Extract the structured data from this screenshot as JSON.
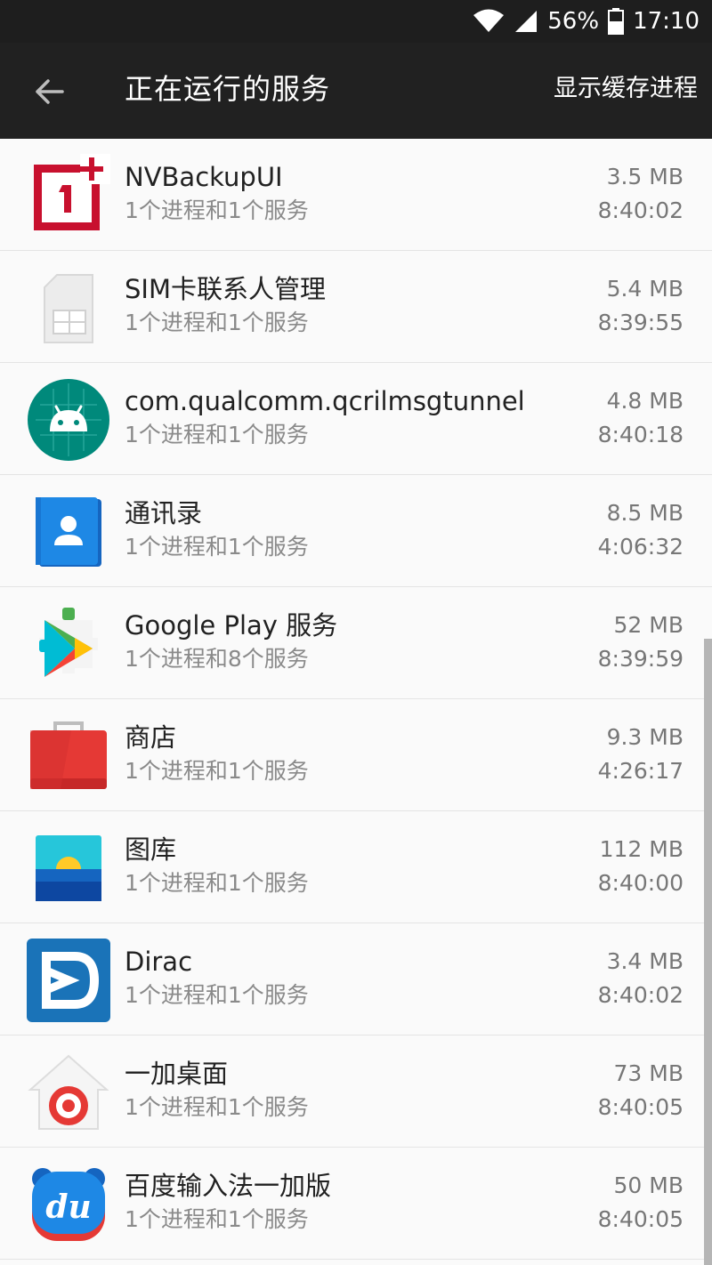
{
  "status_bar": {
    "battery_percent": "56%",
    "time": "17:10",
    "icons": [
      "wifi-icon",
      "signal-icon",
      "battery-icon"
    ]
  },
  "app_bar": {
    "back_icon": "arrow-left-icon",
    "title": "正在运行的服务",
    "action_label": "显示缓存进程"
  },
  "services": [
    {
      "name": "NVBackupUI",
      "desc": "1个进程和1个服务",
      "size": "3.5 MB",
      "time": "8:40:02",
      "icon": "oneplus-icon"
    },
    {
      "name": "SIM卡联系人管理",
      "desc": "1个进程和1个服务",
      "size": "5.4 MB",
      "time": "8:39:55",
      "icon": "sim-card-icon"
    },
    {
      "name": "com.qualcomm.qcrilmsgtunnel",
      "desc": "1个进程和1个服务",
      "size": "4.8 MB",
      "time": "8:40:18",
      "icon": "android-icon"
    },
    {
      "name": "通讯录",
      "desc": "1个进程和1个服务",
      "size": "8.5 MB",
      "time": "4:06:32",
      "icon": "contacts-icon"
    },
    {
      "name": "Google Play 服务",
      "desc": "1个进程和8个服务",
      "size": "52 MB",
      "time": "8:39:59",
      "icon": "google-play-services-icon"
    },
    {
      "name": "商店",
      "desc": "1个进程和1个服务",
      "size": "9.3 MB",
      "time": "4:26:17",
      "icon": "store-bag-icon"
    },
    {
      "name": "图库",
      "desc": "1个进程和1个服务",
      "size": "112 MB",
      "time": "8:40:00",
      "icon": "gallery-icon"
    },
    {
      "name": "Dirac",
      "desc": "1个进程和1个服务",
      "size": "3.4 MB",
      "time": "8:40:02",
      "icon": "dirac-icon"
    },
    {
      "name": "一加桌面",
      "desc": "1个进程和1个服务",
      "size": "73 MB",
      "time": "8:40:05",
      "icon": "launcher-home-icon"
    },
    {
      "name": "百度输入法一加版",
      "desc": "1个进程和1个服务",
      "size": "50 MB",
      "time": "8:40:05",
      "icon": "baidu-input-icon"
    }
  ],
  "colors": {
    "app_bar": "#212121",
    "oneplus_red": "#c8102e",
    "android_teal": "#00897b",
    "contacts_blue": "#1e88e5",
    "store_red": "#e53935",
    "dirac_blue": "#1a73b8"
  }
}
